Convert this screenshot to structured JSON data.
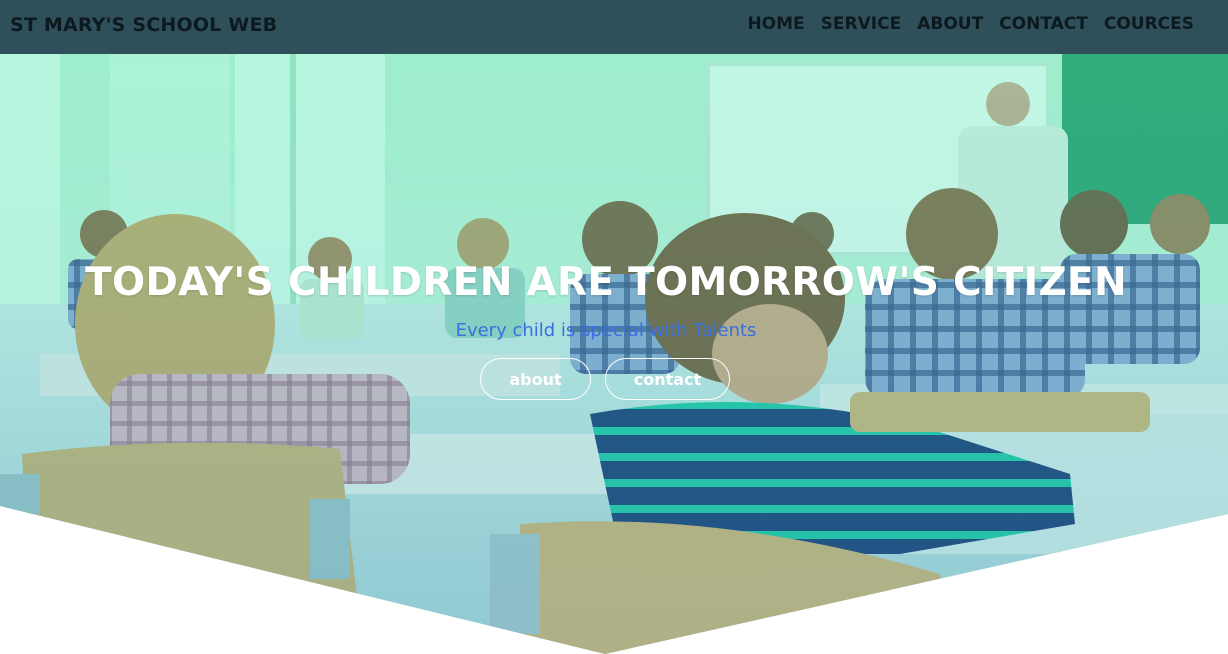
{
  "navbar": {
    "brand": "ST MARY'S SCHOOL WEB",
    "links": [
      "HOME",
      "SERVICE",
      "ABOUT",
      "CONTACT",
      "COURCES"
    ]
  },
  "hero": {
    "title": "TODAY'S CHILDREN ARE TOMORROW'S CITIZEN",
    "subtitle": "Every child is special with Talents",
    "buttons": {
      "about": "about",
      "contact": "contact"
    },
    "image": "classroom-photo"
  },
  "colors": {
    "navbar_bg": "#2f4f5a",
    "nav_text": "#0c1a1f",
    "hero_tint": "#5de3b8",
    "subtitle_text": "#3a6fe0",
    "white": "#ffffff"
  }
}
